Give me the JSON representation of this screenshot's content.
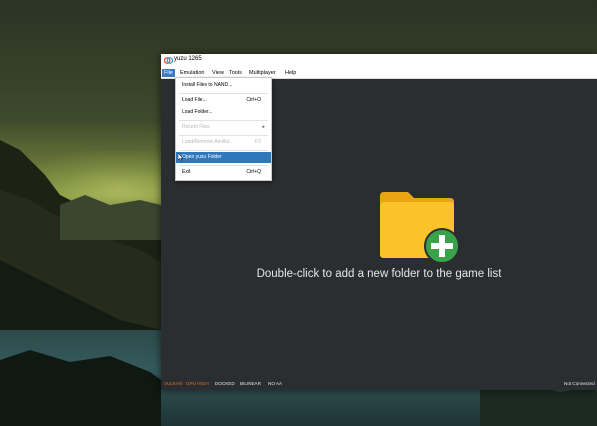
{
  "window": {
    "title": "yuzu 1265",
    "icon": "yuzu-icon"
  },
  "menubar": {
    "items": [
      {
        "label": "File"
      },
      {
        "label": "Emulation"
      },
      {
        "label": "View"
      },
      {
        "label": "Tools"
      },
      {
        "label": "Multiplayer"
      },
      {
        "label": "Help"
      }
    ]
  },
  "file_menu": {
    "items": [
      {
        "label": "Install Files to NAND...",
        "shortcut": "",
        "disabled": false
      },
      {
        "label": "Load File...",
        "shortcut": "Ctrl+O",
        "disabled": false
      },
      {
        "label": "Load Folder...",
        "shortcut": "",
        "disabled": false
      },
      {
        "label": "Recent Files",
        "shortcut": "",
        "disabled": true,
        "submenu": true
      },
      {
        "label": "Load/Remove Amiibo...",
        "shortcut": "F2",
        "disabled": true
      },
      {
        "label": "Open yuzu Folder",
        "shortcut": "",
        "disabled": false,
        "highlighted": true
      },
      {
        "label": "Exit",
        "shortcut": "Ctrl+Q",
        "disabled": false
      }
    ]
  },
  "main": {
    "hint": "Double-click to add a new folder to the game list",
    "folder_icon": "folder-add-icon"
  },
  "statusbar": {
    "items": [
      "VULKAN",
      "GPU HIGH",
      "DOCKED",
      "BILINEAR",
      "NO AA"
    ],
    "connection": "Not Connected"
  },
  "colors": {
    "accent": "#3a78c3",
    "highlight": "#2e78bd",
    "status_orange": "#e86a2a",
    "folder_yellow": "#f9c11f",
    "plus_green": "#3aa34a"
  }
}
